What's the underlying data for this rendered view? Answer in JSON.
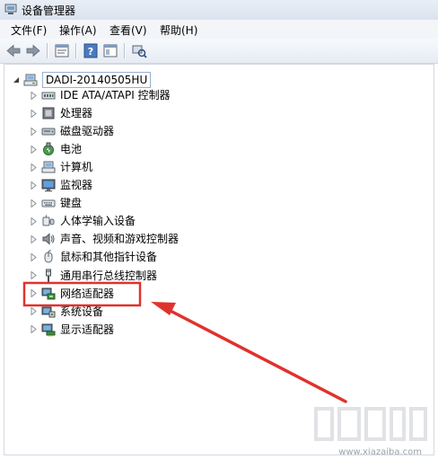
{
  "window": {
    "title": "设备管理器"
  },
  "menu": [
    {
      "id": "file",
      "label": "文件(F)"
    },
    {
      "id": "action",
      "label": "操作(A)"
    },
    {
      "id": "view",
      "label": "查看(V)"
    },
    {
      "id": "help",
      "label": "帮助(H)"
    }
  ],
  "toolbar_icons": [
    "back-arrow-icon",
    "forward-arrow-icon",
    "properties-icon",
    "help-icon",
    "console-icon",
    "scan-hardware-icon"
  ],
  "tree": {
    "root": {
      "label": "DADI-20140505HU",
      "icon": "computer-icon",
      "expanded": true
    },
    "items": [
      {
        "label": "IDE ATA/ATAPI 控制器",
        "icon": "ide-controller-icon"
      },
      {
        "label": "处理器",
        "icon": "processor-icon"
      },
      {
        "label": "磁盘驱动器",
        "icon": "disk-drive-icon"
      },
      {
        "label": "电池",
        "icon": "battery-icon"
      },
      {
        "label": "计算机",
        "icon": "computer-icon"
      },
      {
        "label": "监视器",
        "icon": "monitor-icon"
      },
      {
        "label": "键盘",
        "icon": "keyboard-icon"
      },
      {
        "label": "人体学输入设备",
        "icon": "hid-icon"
      },
      {
        "label": "声音、视频和游戏控制器",
        "icon": "sound-icon"
      },
      {
        "label": "鼠标和其他指针设备",
        "icon": "mouse-icon"
      },
      {
        "label": "通用串行总线控制器",
        "icon": "usb-icon"
      },
      {
        "label": "网络适配器",
        "icon": "network-adapter-icon",
        "highlighted": true
      },
      {
        "label": "系统设备",
        "icon": "system-device-icon"
      },
      {
        "label": "显示适配器",
        "icon": "display-adapter-icon"
      }
    ]
  },
  "annotation": {
    "highlight_color": "#e0322c",
    "arrow_color": "#e0322c"
  },
  "watermark": {
    "text": "www.xiazaiba.com"
  }
}
